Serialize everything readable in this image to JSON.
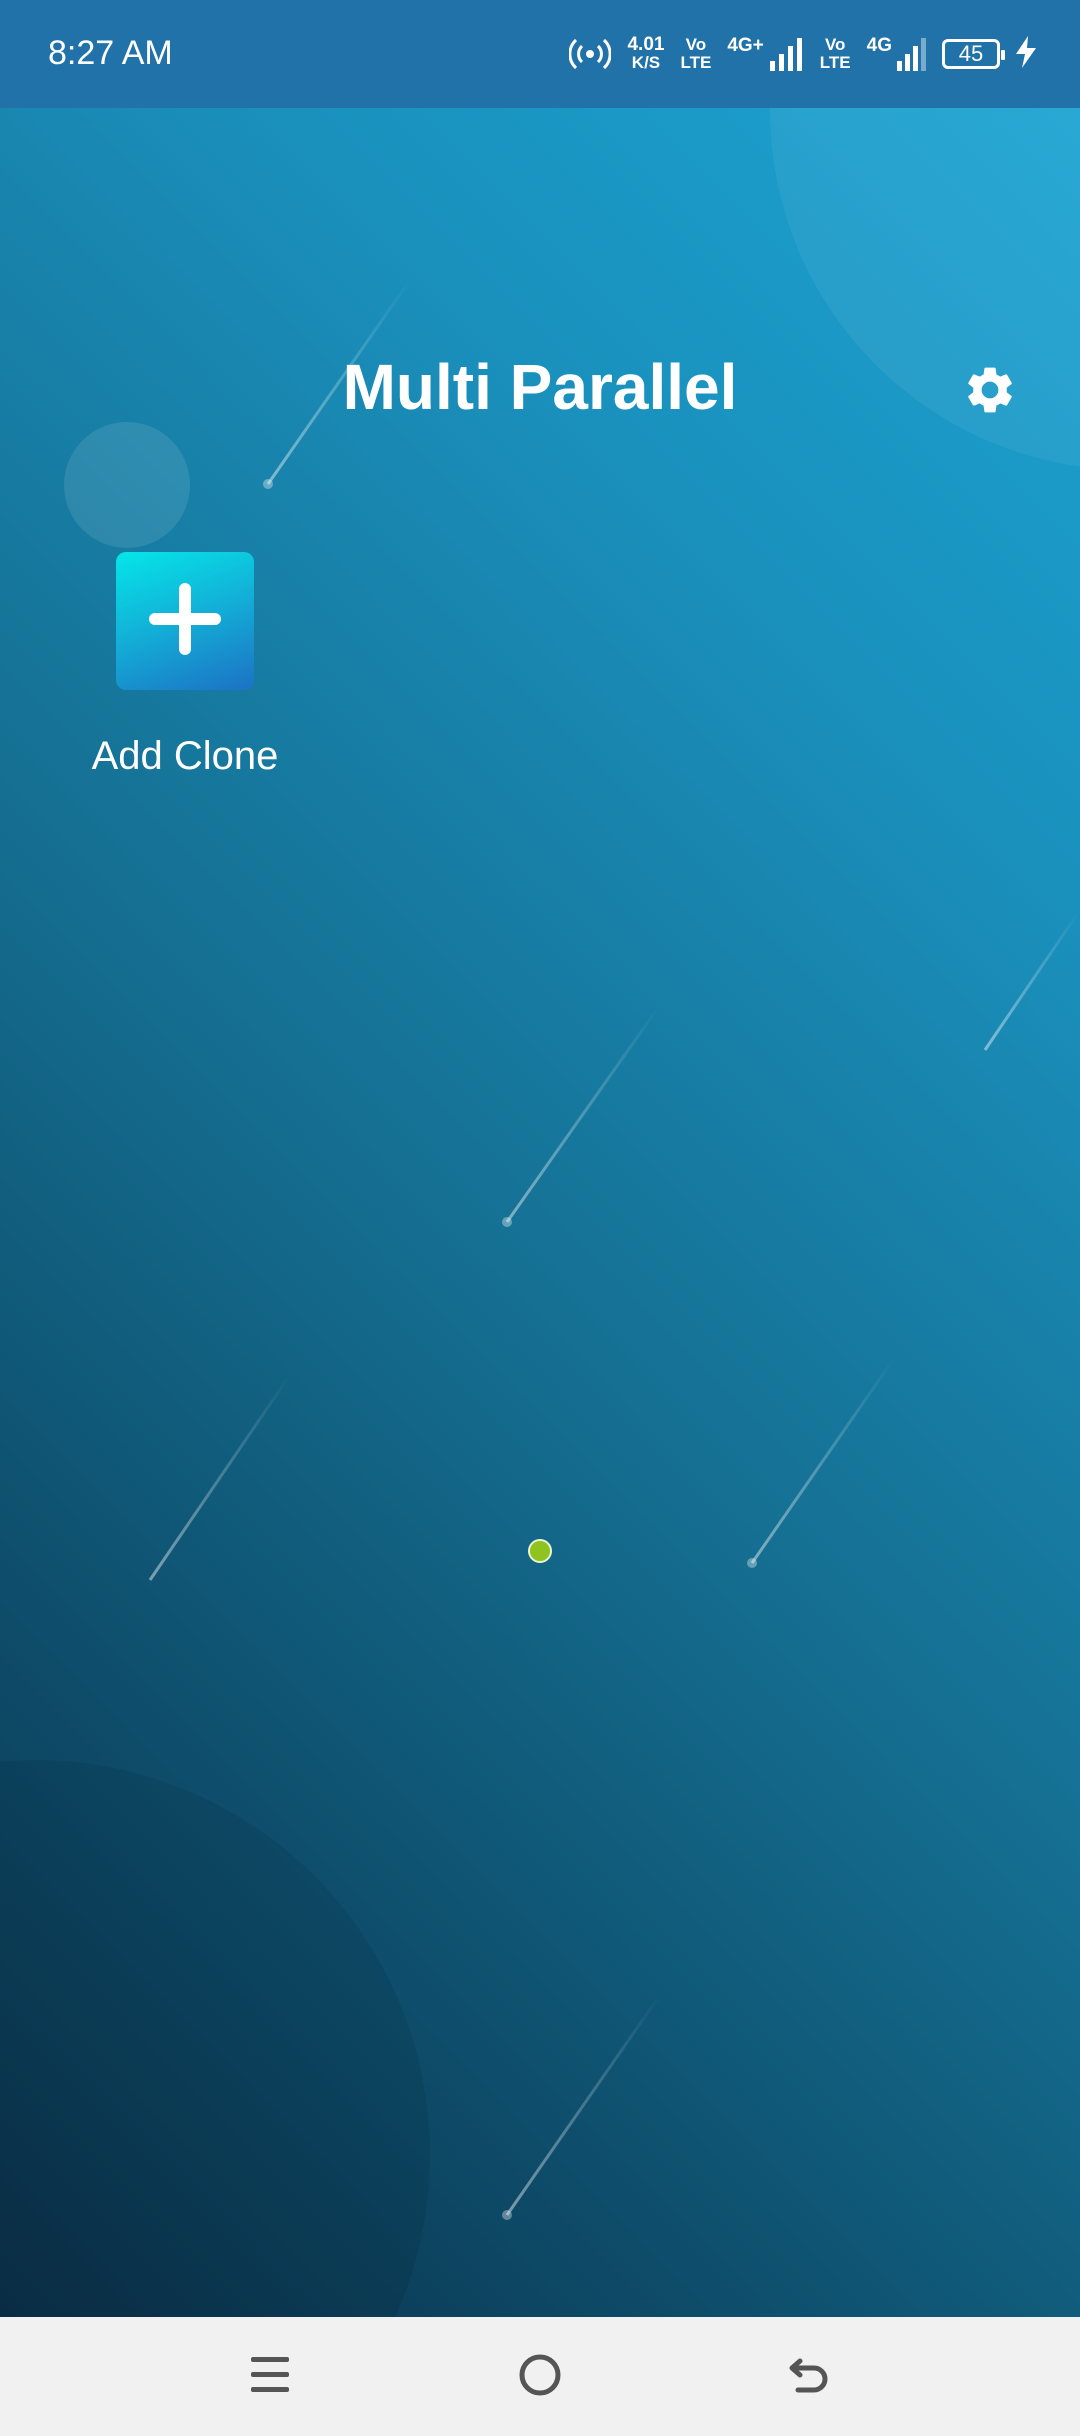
{
  "status_bar": {
    "time": "8:27 AM",
    "network_speed_value": "4.01",
    "network_speed_unit": "K/S",
    "volte1_top": "Vo",
    "volte1_bottom": "LTE",
    "sim1_type": "4G+",
    "volte2_top": "Vo",
    "volte2_bottom": "LTE",
    "sim2_type": "4G",
    "battery_level": "45"
  },
  "header": {
    "title": "Multi Parallel"
  },
  "clone": {
    "add_label": "Add Clone"
  },
  "page_indicator": {
    "total": 1,
    "current": 1
  },
  "colors": {
    "status_bar": "#2272aa",
    "accent_dot": "#8fc31f",
    "tile_start": "#05e6e9",
    "tile_end": "#1c72c4",
    "nav_bar": "#f1f1f1",
    "nav_icon": "#555555"
  },
  "icons": {
    "settings": "gear-icon",
    "add": "plus-icon",
    "hotspot": "hotspot-icon",
    "charging": "charging-bolt-icon",
    "nav_menu": "menu-icon",
    "nav_home": "home-circle-icon",
    "nav_back": "back-icon"
  }
}
